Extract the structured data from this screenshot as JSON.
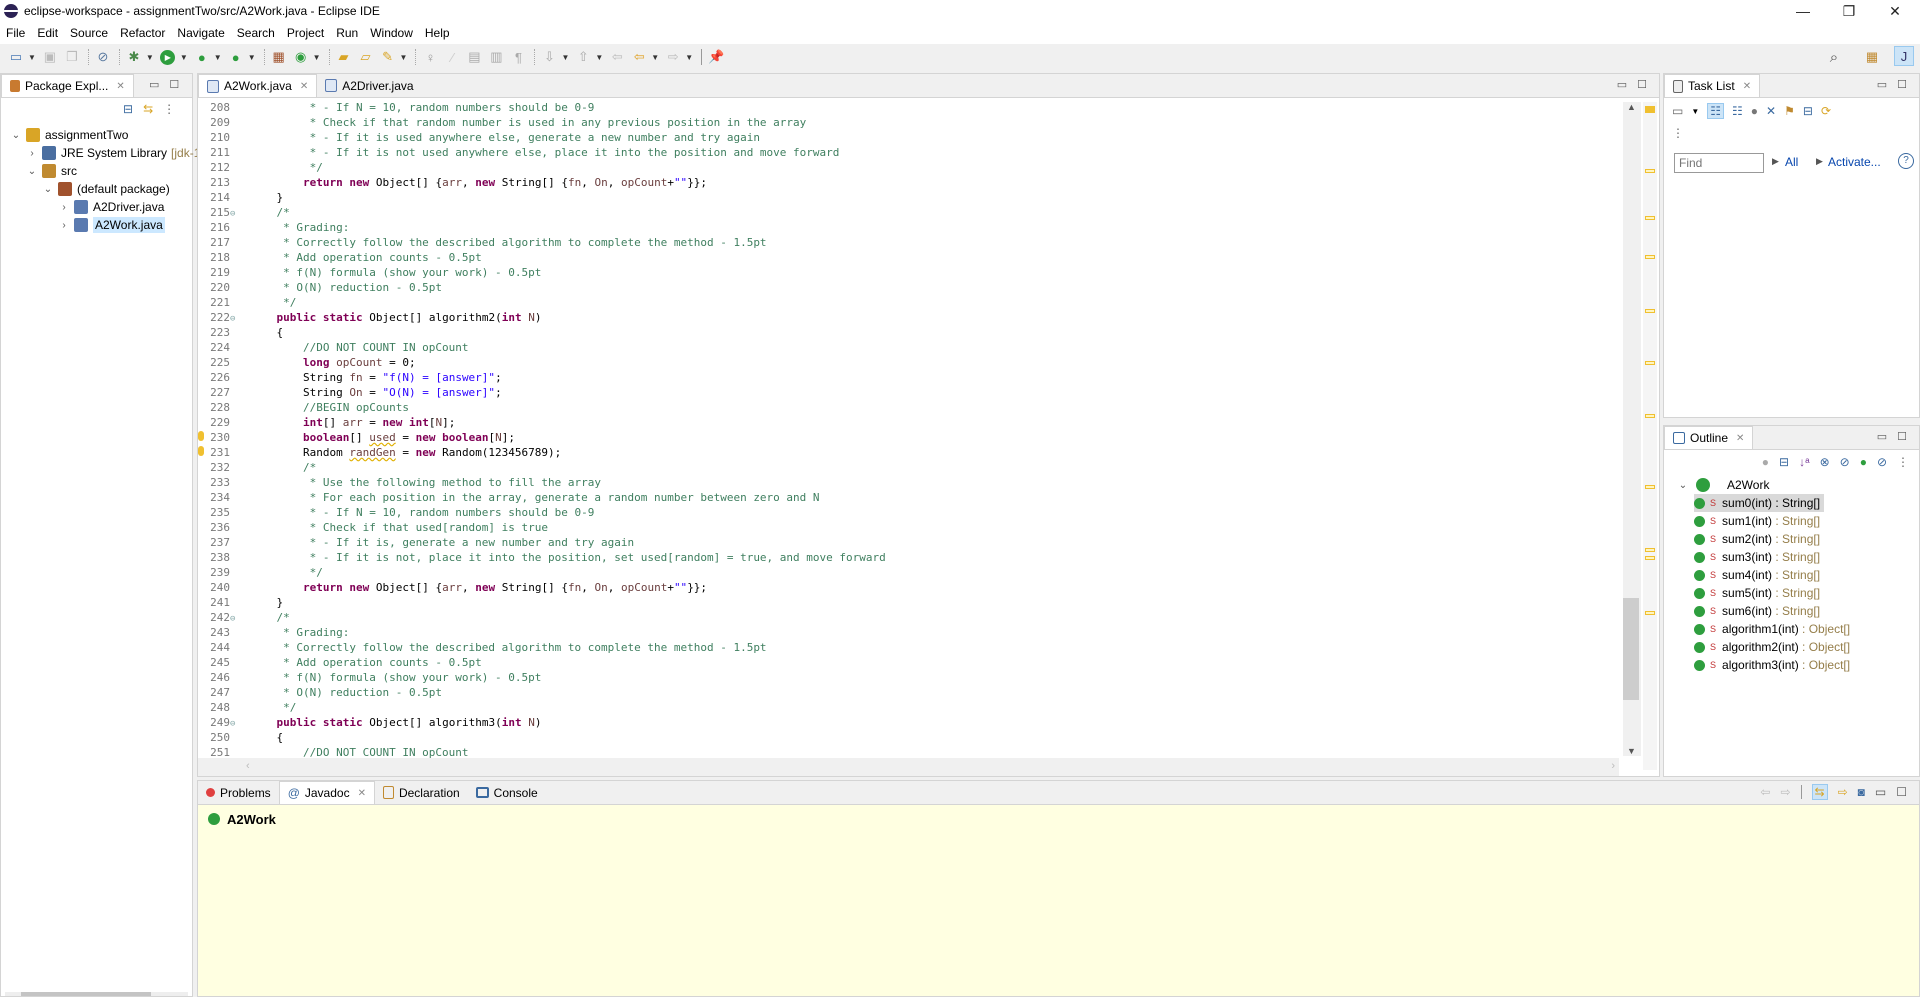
{
  "window": {
    "title": "eclipse-workspace - assignmentTwo/src/A2Work.java - Eclipse IDE",
    "minimize": "—",
    "restore": "❐",
    "close": "✕"
  },
  "menu": [
    "File",
    "Edit",
    "Source",
    "Refactor",
    "Navigate",
    "Search",
    "Project",
    "Run",
    "Window",
    "Help"
  ],
  "package_explorer": {
    "title": "Package Expl...",
    "tree": [
      {
        "label": "assignmentTwo",
        "depth": 0,
        "expanded": true
      },
      {
        "label": "JRE System Library",
        "suffix": "[jdk-1",
        "depth": 1,
        "expanded": false
      },
      {
        "label": "src",
        "depth": 1,
        "expanded": true
      },
      {
        "label": "(default package)",
        "depth": 2,
        "expanded": true
      },
      {
        "label": "A2Driver.java",
        "depth": 3,
        "expanded": false
      },
      {
        "label": "A2Work.java",
        "depth": 3,
        "expanded": false,
        "selected": true
      }
    ]
  },
  "editor": {
    "tabs": [
      {
        "label": "A2Work.java",
        "active": true
      },
      {
        "label": "A2Driver.java",
        "active": false
      }
    ],
    "lines": [
      {
        "n": "208",
        "html": "<span class='cm'>         * - If N = 10, random numbers should be 0-9</span>"
      },
      {
        "n": "209",
        "html": "<span class='cm'>         * Check if that random number is used in any previous position in the array</span>"
      },
      {
        "n": "210",
        "html": "<span class='cm'>         * - If it is used anywhere else, generate a new number and try again</span>"
      },
      {
        "n": "211",
        "html": "<span class='cm'>         * - If it is not used anywhere else, place it into the position and move forward</span>"
      },
      {
        "n": "212",
        "html": "<span class='cm'>         */</span>"
      },
      {
        "n": "213",
        "html": "        <span class='kw'>return</span> <span class='kw'>new</span> Object[] {<span class='vr'>arr</span>, <span class='kw'>new</span> String[] {<span class='vr'>fn</span>, <span class='vr'>On</span>, <span class='vr'>opCount</span>+<span class='st'>\"\"</span>}};"
      },
      {
        "n": "214",
        "html": "    }"
      },
      {
        "n": "215",
        "fold": true,
        "html": "<span class='cm'>    /*</span>"
      },
      {
        "n": "216",
        "html": "<span class='cm'>     * Grading:</span>"
      },
      {
        "n": "217",
        "html": "<span class='cm'>     * Correctly follow the described algorithm to complete the method - 1.5pt</span>"
      },
      {
        "n": "218",
        "html": "<span class='cm'>     * Add operation counts - 0.5pt</span>"
      },
      {
        "n": "219",
        "html": "<span class='cm'>     * f(N) formula (show your work) - 0.5pt</span>"
      },
      {
        "n": "220",
        "html": "<span class='cm'>     * O(N) reduction - 0.5pt</span>"
      },
      {
        "n": "221",
        "html": "<span class='cm'>     */</span>"
      },
      {
        "n": "222",
        "fold": true,
        "html": "    <span class='kw'>public</span> <span class='kw'>static</span> Object[] algorithm2(<span class='kw'>int</span> <span class='vr'>N</span>)"
      },
      {
        "n": "223",
        "html": "    {"
      },
      {
        "n": "224",
        "html": "<span class='cm'>        //DO NOT COUNT IN opCount</span>"
      },
      {
        "n": "225",
        "html": "        <span class='kw'>long</span> <span class='vr'>opCount</span> = 0;"
      },
      {
        "n": "226",
        "html": "        String <span class='vr'>fn</span> = <span class='st'>\"f(N) = [answer]\"</span>;"
      },
      {
        "n": "227",
        "html": "        String <span class='vr'>On</span> = <span class='st'>\"O(N) = [answer]\"</span>;"
      },
      {
        "n": "228",
        "html": "<span class='cm'>        //BEGIN opCounts</span>"
      },
      {
        "n": "229",
        "html": "        <span class='kw'>int</span>[] <span class='vr'>arr</span> = <span class='kw'>new</span> <span class='kw'>int</span>[<span class='vr'>N</span>];"
      },
      {
        "n": "230",
        "warn": true,
        "html": "        <span class='kw'>boolean</span>[] <span class='vr' style='text-decoration:underline wavy #e0b000'>used</span> = <span class='kw'>new</span> <span class='kw'>boolean</span>[<span class='vr'>N</span>];"
      },
      {
        "n": "231",
        "warn": true,
        "html": "        Random <span class='vr' style='text-decoration:underline wavy #e0b000'>randGen</span> = <span class='kw'>new</span> Random(123456789);"
      },
      {
        "n": "232",
        "html": "<span class='cm'>        /*</span>"
      },
      {
        "n": "233",
        "html": "<span class='cm'>         * Use the following method to fill the array</span>"
      },
      {
        "n": "234",
        "html": "<span class='cm'>         * For each position in the array, generate a random number between zero and N</span>"
      },
      {
        "n": "235",
        "html": "<span class='cm'>         * - If N = 10, random numbers should be 0-9</span>"
      },
      {
        "n": "236",
        "html": "<span class='cm'>         * Check if that used[random] is true</span>"
      },
      {
        "n": "237",
        "html": "<span class='cm'>         * - If it is, generate a new number and try again</span>"
      },
      {
        "n": "238",
        "html": "<span class='cm'>         * - If it is not, place it into the position, set used[random] = true, and move forward</span>"
      },
      {
        "n": "239",
        "html": "<span class='cm'>         */</span>"
      },
      {
        "n": "240",
        "html": "        <span class='kw'>return</span> <span class='kw'>new</span> Object[] {<span class='vr'>arr</span>, <span class='kw'>new</span> String[] {<span class='vr'>fn</span>, <span class='vr'>On</span>, <span class='vr'>opCount</span>+<span class='st'>\"\"</span>}};"
      },
      {
        "n": "241",
        "html": "    }"
      },
      {
        "n": "242",
        "fold": true,
        "html": "<span class='cm'>    /*</span>"
      },
      {
        "n": "243",
        "html": "<span class='cm'>     * Grading:</span>"
      },
      {
        "n": "244",
        "html": "<span class='cm'>     * Correctly follow the described algorithm to complete the method - 1.5pt</span>"
      },
      {
        "n": "245",
        "html": "<span class='cm'>     * Add operation counts - 0.5pt</span>"
      },
      {
        "n": "246",
        "html": "<span class='cm'>     * f(N) formula (show your work) - 0.5pt</span>"
      },
      {
        "n": "247",
        "html": "<span class='cm'>     * O(N) reduction - 0.5pt</span>"
      },
      {
        "n": "248",
        "html": "<span class='cm'>     */</span>"
      },
      {
        "n": "249",
        "fold": true,
        "html": "    <span class='kw'>public</span> <span class='kw'>static</span> Object[] algorithm3(<span class='kw'>int</span> <span class='vr'>N</span>)"
      },
      {
        "n": "250",
        "html": "    {"
      },
      {
        "n": "251",
        "html": "<span class='cm'>        //DO NOT COUNT IN opCount</span>"
      }
    ]
  },
  "task_list": {
    "title": "Task List",
    "find_placeholder": "Find",
    "all_label": "All",
    "activate_label": "Activate...",
    "help": "?"
  },
  "outline": {
    "title": "Outline",
    "root": "A2Work",
    "items": [
      {
        "name": "sum0(int)",
        "type": " : String[]",
        "selected": true
      },
      {
        "name": "sum1(int)",
        "type": " : String[]"
      },
      {
        "name": "sum2(int)",
        "type": " : String[]"
      },
      {
        "name": "sum3(int)",
        "type": " : String[]"
      },
      {
        "name": "sum4(int)",
        "type": " : String[]"
      },
      {
        "name": "sum5(int)",
        "type": " : String[]"
      },
      {
        "name": "sum6(int)",
        "type": " : String[]"
      },
      {
        "name": "algorithm1(int)",
        "type": " : Object[]"
      },
      {
        "name": "algorithm2(int)",
        "type": " : Object[]"
      },
      {
        "name": "algorithm3(int)",
        "type": " : Object[]"
      }
    ]
  },
  "bottom": {
    "tabs": [
      {
        "label": "Problems"
      },
      {
        "label": "Javadoc",
        "active": true
      },
      {
        "label": "Declaration"
      },
      {
        "label": "Console"
      }
    ],
    "javadoc_title": "A2Work"
  },
  "colors": {
    "javadoc_bg": "#ffffe1",
    "selection": "#cce8ff",
    "comment": "#3f7f5f",
    "keyword": "#7f0055",
    "string": "#2a00ff"
  }
}
